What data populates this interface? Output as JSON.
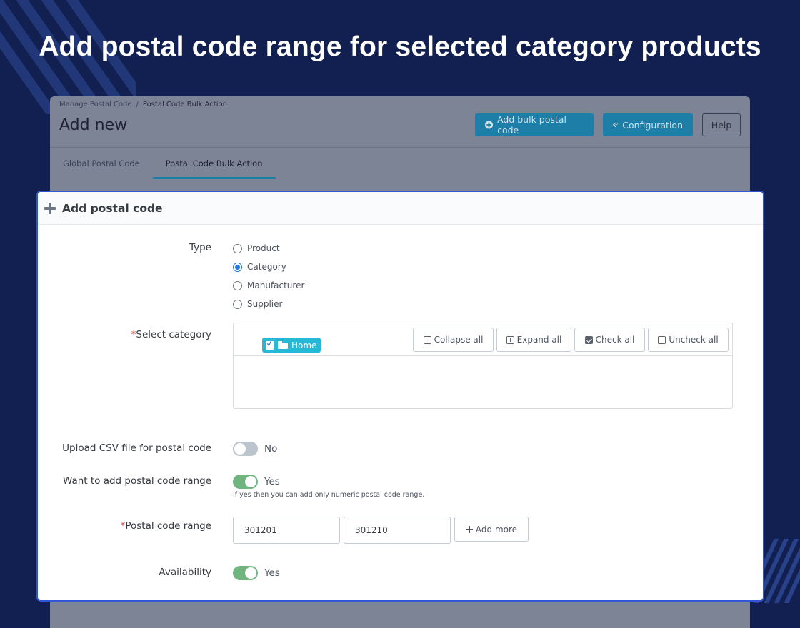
{
  "headline": "Add postal code range for selected category products",
  "admin": {
    "breadcrumb": [
      "Manage Postal Code",
      "/",
      "Postal Code Bulk Action"
    ],
    "title": "Add new",
    "buttons": {
      "add_bulk": "Add bulk postal code",
      "configuration": "Configuration",
      "help": "Help"
    },
    "tabs": [
      "Global Postal Code",
      "Postal Code Bulk Action"
    ],
    "active_tab": "Postal Code Bulk Action"
  },
  "panel": {
    "title": "Add postal code",
    "type": {
      "label": "Type",
      "options": [
        "Product",
        "Category",
        "Manufacturer",
        "Supplier"
      ],
      "selected": "Category"
    },
    "category": {
      "required_mark": "*",
      "label": "Select category",
      "toolbar": {
        "collapse": "Collapse all",
        "expand": "Expand all",
        "check": "Check all",
        "uncheck": "Uncheck all"
      },
      "node": "Home",
      "node_checked": true
    },
    "csv": {
      "label": "Upload CSV file for postal code",
      "value": "No",
      "on": false
    },
    "range_toggle": {
      "label": "Want to add postal code range",
      "value": "Yes",
      "on": true,
      "hint": "If yes then you can add only numeric postal code range."
    },
    "range": {
      "required_mark": "*",
      "label": "Postal code range",
      "from": "301201",
      "to": "301210",
      "add_more": "Add more"
    },
    "availability": {
      "label": "Availability",
      "value": "Yes",
      "on": true
    }
  },
  "colors": {
    "background": "#122051",
    "highlight_border": "#2f55d4",
    "primary_button": "#1d7fa7",
    "switch_on": "#70b580",
    "tree_node": "#25b9d7",
    "required": "#e3443a"
  }
}
